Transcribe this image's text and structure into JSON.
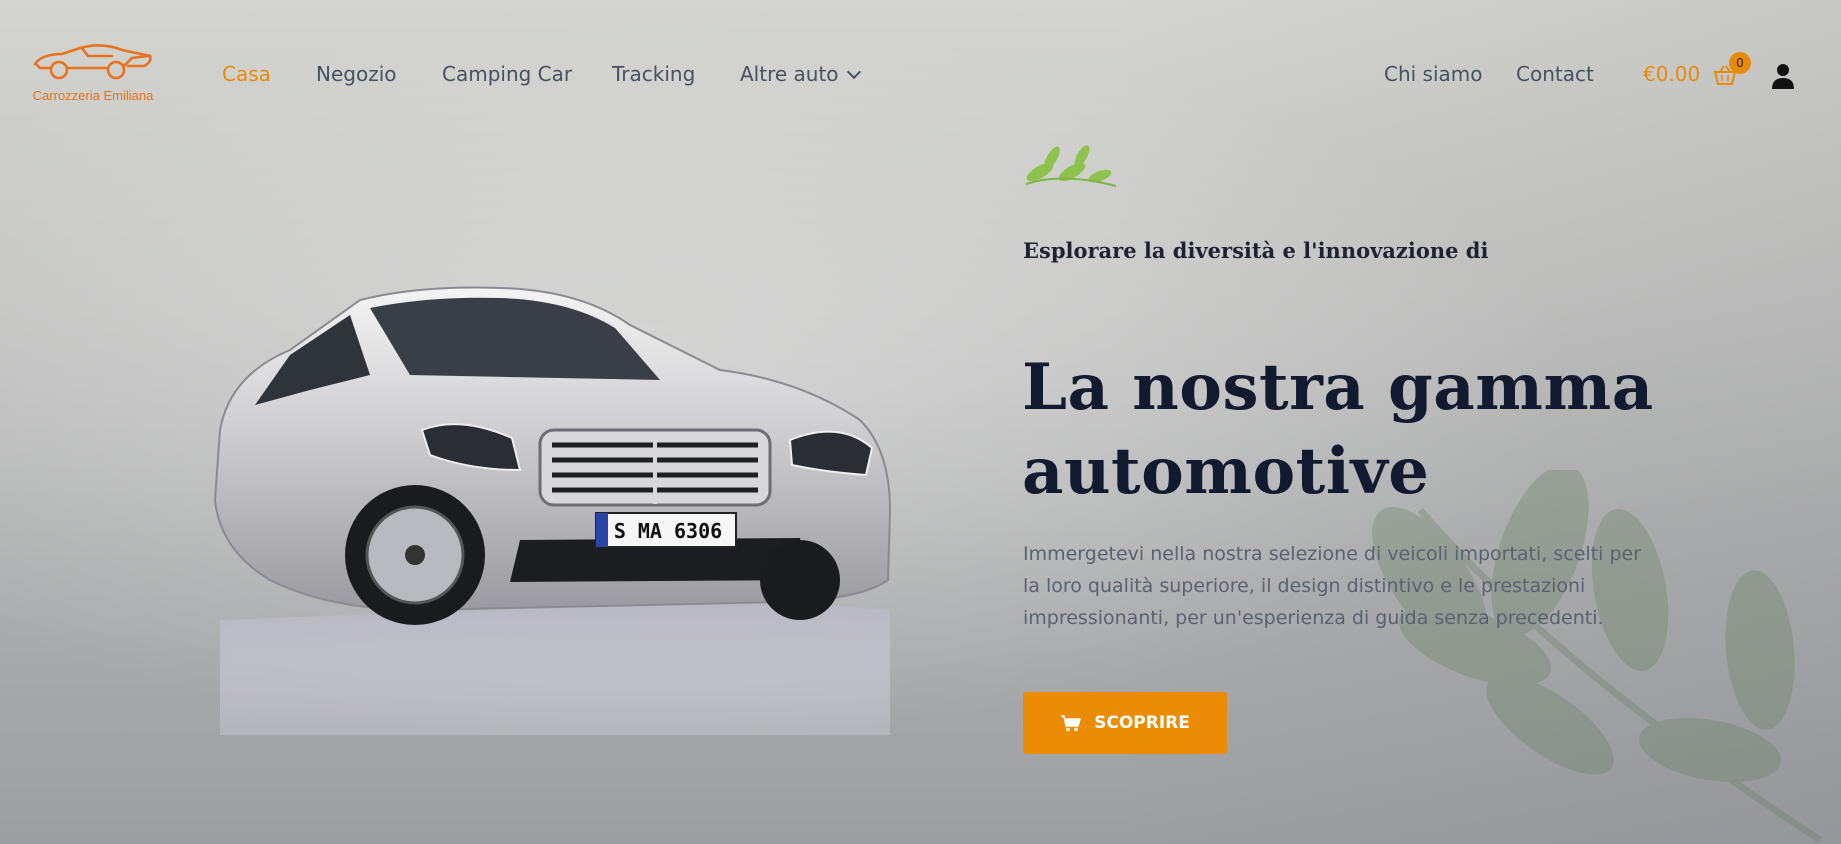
{
  "brand": {
    "name": "Carrozzeria Emiliana",
    "accent_color": "#e88a0c",
    "logo_color": "#e8721c"
  },
  "nav": {
    "items": [
      {
        "label": "Casa",
        "active": true
      },
      {
        "label": "Negozio",
        "active": false
      },
      {
        "label": "Camping Car",
        "active": false
      },
      {
        "label": "Tracking",
        "active": false
      },
      {
        "label": "Altre auto",
        "active": false,
        "has_dropdown": true
      }
    ],
    "right_items": [
      {
        "label": "Chi siamo"
      },
      {
        "label": "Contact"
      }
    ]
  },
  "cart": {
    "total": "€0.00",
    "count": "0",
    "icon": "basket-icon"
  },
  "account": {
    "icon": "user-icon"
  },
  "hero": {
    "subtitle": "Esplorare la diversità e l'innovazione di",
    "headline_line1": "La nostra gamma",
    "headline_line2": "automotive",
    "description": "Immergetevi nella nostra selezione di veicoli importati, scelti per la loro qualità superiore, il design distintivo e le prestazioni impressionanti, per un'esperienza di guida senza precedenti.",
    "cta_label": "SCOPRIRE",
    "cta_icon": "cart-icon",
    "car_plate": "S MA 6306"
  }
}
